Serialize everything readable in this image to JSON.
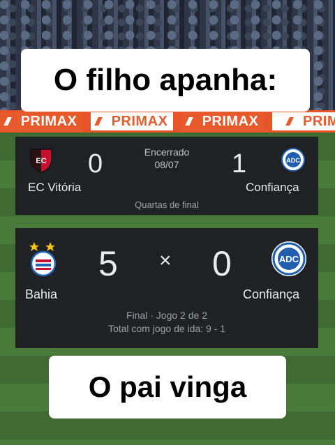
{
  "captions": {
    "top": "O filho apanha:",
    "bottom": "O pai vinga"
  },
  "ads": [
    "PRIMAX",
    "PRIMAX",
    "PRIMAX",
    "PRIM"
  ],
  "match1": {
    "home_team": "EC Vitória",
    "home_score": "0",
    "away_team": "Confiança",
    "away_score": "1",
    "status": "Encerrado",
    "date": "08/07",
    "round": "Quartas de final"
  },
  "match2": {
    "home_team": "Bahia",
    "home_score": "5",
    "separator": "×",
    "away_score": "0",
    "away_team": "Confiança",
    "stage": "Final · Jogo 2 de 2",
    "aggregate": "Total com jogo de ida: 9 - 1"
  },
  "colors": {
    "card_bg": "#202124",
    "ad_orange": "#e65a2b",
    "vitoria_red": "#c8102e",
    "confianca_blue": "#1f5fae",
    "bahia_blue": "#1e63b6"
  }
}
